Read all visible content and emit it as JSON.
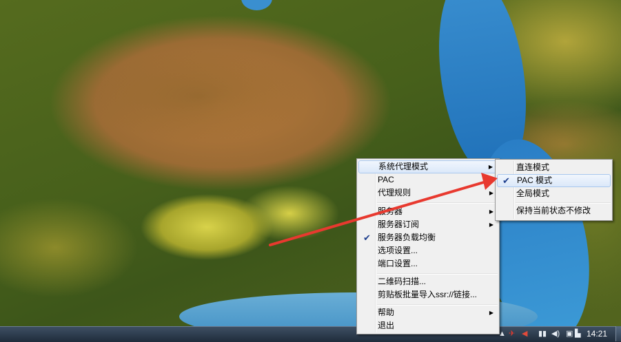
{
  "main_menu": {
    "items": [
      {
        "label": "系统代理模式",
        "submenu": true,
        "checked": false
      },
      {
        "label": "PAC",
        "submenu": true,
        "checked": false
      },
      {
        "label": "代理规则",
        "submenu": true,
        "checked": false
      },
      {
        "label": "服务器",
        "submenu": true,
        "checked": false
      },
      {
        "label": "服务器订阅",
        "submenu": true,
        "checked": false
      },
      {
        "label": "服务器负载均衡",
        "submenu": false,
        "checked": true
      },
      {
        "label": "选项设置...",
        "submenu": false,
        "checked": false
      },
      {
        "label": "端口设置...",
        "submenu": false,
        "checked": false
      },
      {
        "label": "二维码扫描...",
        "submenu": false,
        "checked": false
      },
      {
        "label": "剪贴板批量导入ssr://链接...",
        "submenu": false,
        "checked": false
      },
      {
        "label": "帮助",
        "submenu": true,
        "checked": false
      },
      {
        "label": "退出",
        "submenu": false,
        "checked": false
      }
    ]
  },
  "sub_menu": {
    "items": [
      {
        "label": "直连模式",
        "checked": false
      },
      {
        "label": "PAC 模式",
        "checked": true
      },
      {
        "label": "全局模式",
        "checked": false
      },
      {
        "label": "保持当前状态不修改",
        "checked": false
      }
    ]
  },
  "taskbar": {
    "clock": "14:21"
  },
  "colors": {
    "annotation_arrow": "#e8392f",
    "menu_bg": "#f0f0f0",
    "check": "#1b3c8c"
  },
  "icons": {
    "check": "check-icon",
    "submenu_arrow": "triangle-right-icon"
  }
}
